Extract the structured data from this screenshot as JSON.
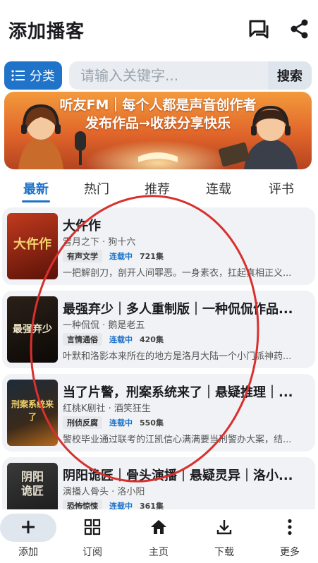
{
  "header": {
    "title": "添加播客"
  },
  "search": {
    "category_label": "分类",
    "placeholder": "请输入关键字...",
    "button_label": "搜索"
  },
  "banner": {
    "line1": "听友FM｜每个人都是声音创作者",
    "line2": "发布作品→收获分享快乐"
  },
  "tabs": [
    "最新",
    "热门",
    "推荐",
    "连载",
    "评书"
  ],
  "active_tab": "最新",
  "podcasts": [
    {
      "title": "大仵作",
      "author": "雪月之下 · 狗十六",
      "genre": "有声文学",
      "status": "连载中",
      "episodes": "721集",
      "desc": "一把解剖刀，剖开人间罪恶。一身素衣，扛起真相正义...",
      "cover_text": "大仵作"
    },
    {
      "title": "最强弃少｜多人重制版｜一种侃侃作品...",
      "author": "一种侃侃 · 鹅是老五",
      "genre": "言情通俗",
      "status": "连载中",
      "episodes": "420集",
      "desc": "叶默和洛影本来所在的地方是洛月大陆一个小门派神药...",
      "cover_text": "最强弃少"
    },
    {
      "title": "当了片警，刑案系统来了｜悬疑推理｜...",
      "author": "红桃K剧社 · 酒笑狂生",
      "genre": "刑侦反腐",
      "status": "连载中",
      "episodes": "550集",
      "desc": "警校毕业通过联考的江凯信心满满要当刑警办大案，结...",
      "cover_text": "刑案系统来了"
    },
    {
      "title": "阴阳诡匠｜骨头演播｜悬疑灵异｜洛小...",
      "author": "演播人骨头 · 洛小阳",
      "genre": "恐怖惊悚",
      "status": "连载中",
      "episodes": "361集",
      "desc": "",
      "cover_text": "阴阳诡匠"
    }
  ],
  "bottom_nav": [
    {
      "label": "添加",
      "icon": "plus-icon"
    },
    {
      "label": "订阅",
      "icon": "grid-icon"
    },
    {
      "label": "主页",
      "icon": "home-icon"
    },
    {
      "label": "下载",
      "icon": "download-icon"
    },
    {
      "label": "更多",
      "icon": "more-vertical-icon"
    }
  ],
  "colors": {
    "accent": "#1f73c9",
    "annotation": "#d9302e",
    "card_bg": "#f0f2f5"
  }
}
